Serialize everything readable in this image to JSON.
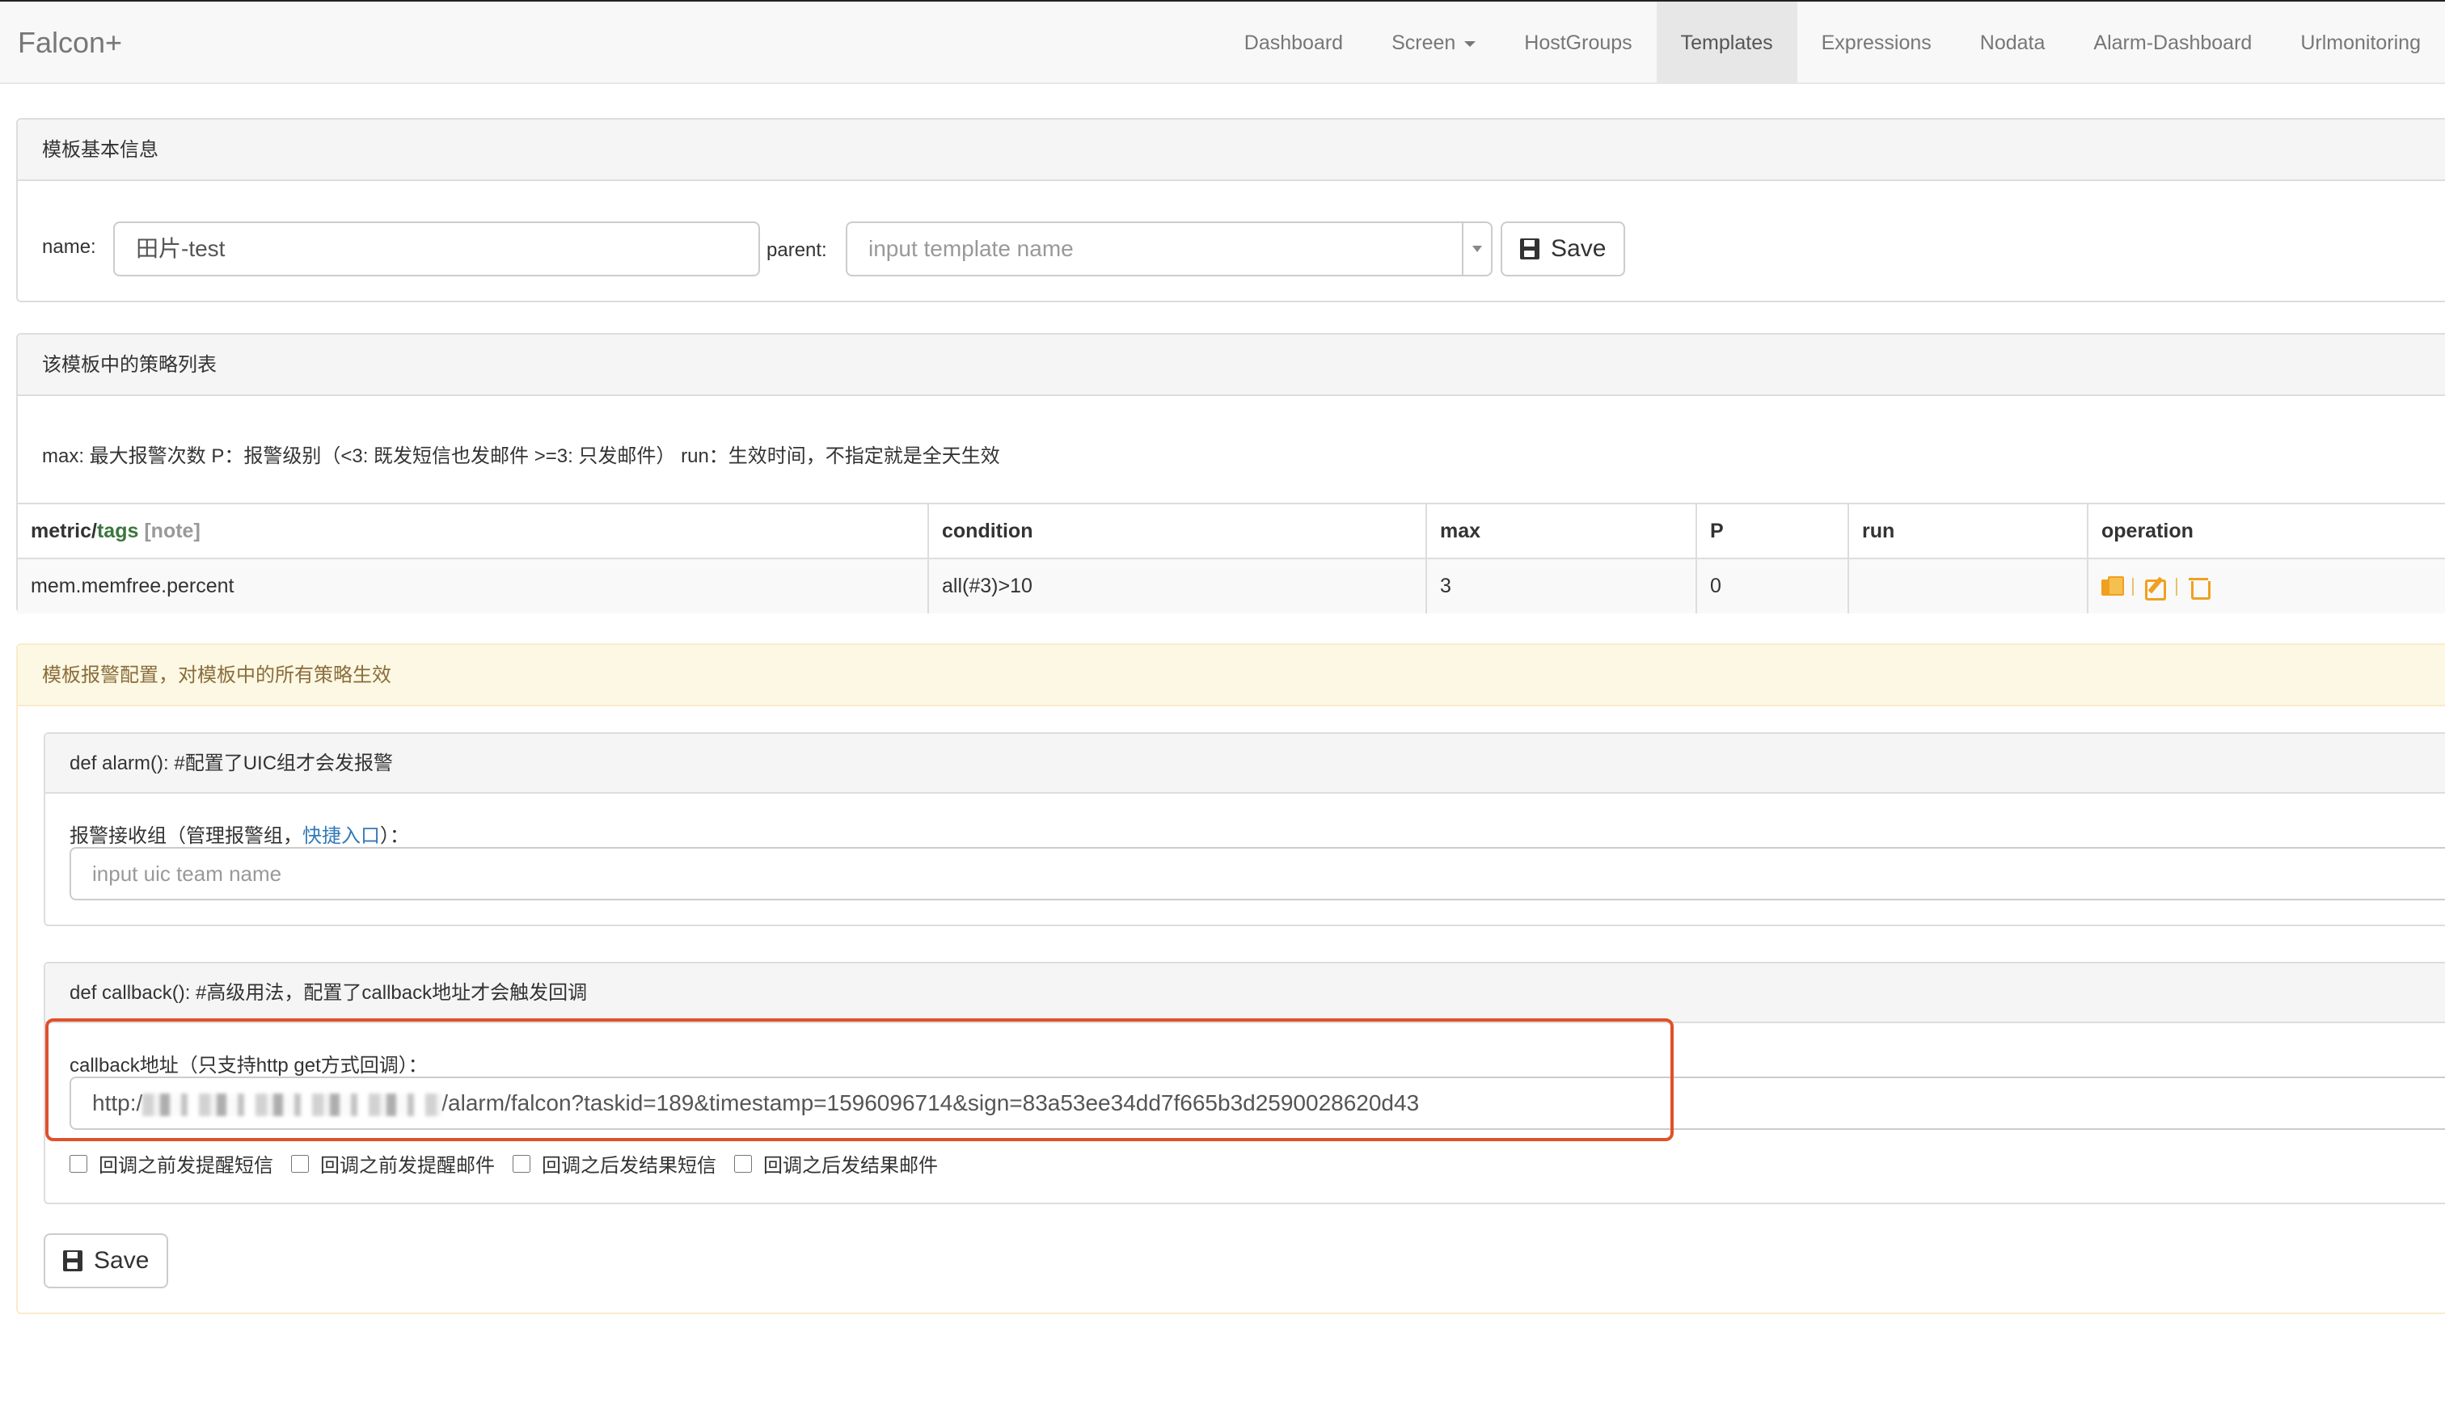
{
  "navbar": {
    "brand": "Falcon+",
    "items": [
      {
        "label": "Dashboard"
      },
      {
        "label": "Screen"
      },
      {
        "label": "HostGroups"
      },
      {
        "label": "Templates"
      },
      {
        "label": "Expressions"
      },
      {
        "label": "Nodata"
      },
      {
        "label": "Alarm-Dashboard"
      },
      {
        "label": "Urlmonitoring"
      }
    ],
    "active": "Templates"
  },
  "template_info": {
    "heading": "模板基本信息",
    "name_label": "name:",
    "name_value": "田片-test",
    "parent_label": "parent:",
    "parent_placeholder": "input template name",
    "save_label": "Save"
  },
  "strategy_list": {
    "heading": "该模板中的策略列表",
    "description": "max: 最大报警次数 P：报警级别（<3: 既发短信也发邮件 >=3: 只发邮件） run：生效时间，不指定就是全天生效",
    "columns": {
      "metric": "metric/",
      "tags": "tags",
      "note": "[note]",
      "condition": "condition",
      "max": "max",
      "p": "P",
      "run": "run",
      "operation": "operation"
    },
    "rows": [
      {
        "metric": "mem.memfree.percent",
        "condition": "all(#3)>10",
        "max": "3",
        "p": "0",
        "run": ""
      }
    ]
  },
  "alarm_config": {
    "heading": "模板报警配置，对模板中的所有策略生效",
    "alarm": {
      "heading": "def alarm(): #配置了UIC组才会发报警",
      "label_prefix": "报警接收组（管理报警组，",
      "label_link": "快捷入口",
      "label_suffix": "）：",
      "placeholder": "input uic team name"
    },
    "callback": {
      "heading": "def callback(): #高级用法，配置了callback地址才会触发回调",
      "label": "callback地址（只支持http get方式回调）：",
      "url_prefix": "http:/",
      "url_suffix": "/alarm/falcon?taskid=189&timestamp=1596096714&sign=83a53ee34dd7f665b3d2590028620d43",
      "checkboxes": [
        {
          "label": "回调之前发提醒短信",
          "checked": false
        },
        {
          "label": "回调之前发提醒邮件",
          "checked": false
        },
        {
          "label": "回调之后发结果短信",
          "checked": false
        },
        {
          "label": "回调之后发结果邮件",
          "checked": false
        }
      ]
    },
    "save_label": "Save"
  },
  "colors": {
    "highlight": "#e0512a",
    "warning_bg": "#fcf8e3",
    "link": "#337ab7",
    "icon": "#f0a020"
  }
}
